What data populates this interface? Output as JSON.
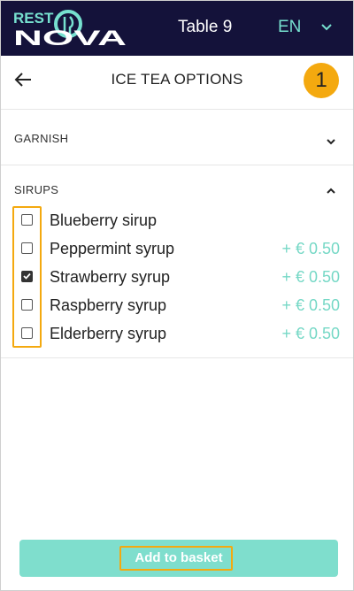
{
  "app": {
    "logo_top": "REST",
    "logo_bottom": "NOVA",
    "table": "Table 9",
    "language": "EN"
  },
  "page": {
    "title": "ICE TEA OPTIONS",
    "step": "1"
  },
  "sections": {
    "garnish": {
      "title": "GARNISH",
      "expanded": false
    },
    "sirups": {
      "title": "SIRUPS",
      "expanded": true,
      "items": [
        {
          "label": "Blueberry sirup",
          "price": "",
          "checked": false
        },
        {
          "label": "Peppermint syrup",
          "price": "+ € 0.50",
          "checked": false
        },
        {
          "label": "Strawberry syrup",
          "price": "+ € 0.50",
          "checked": true
        },
        {
          "label": "Raspberry syrup",
          "price": "+ € 0.50",
          "checked": false
        },
        {
          "label": "Elderberry syrup",
          "price": "+ € 0.50",
          "checked": false
        }
      ]
    }
  },
  "actions": {
    "add_to_basket": "Add to basket"
  },
  "colors": {
    "header_bg": "#14123a",
    "accent_teal": "#76e0cf",
    "highlight_orange": "#f4a90f"
  }
}
